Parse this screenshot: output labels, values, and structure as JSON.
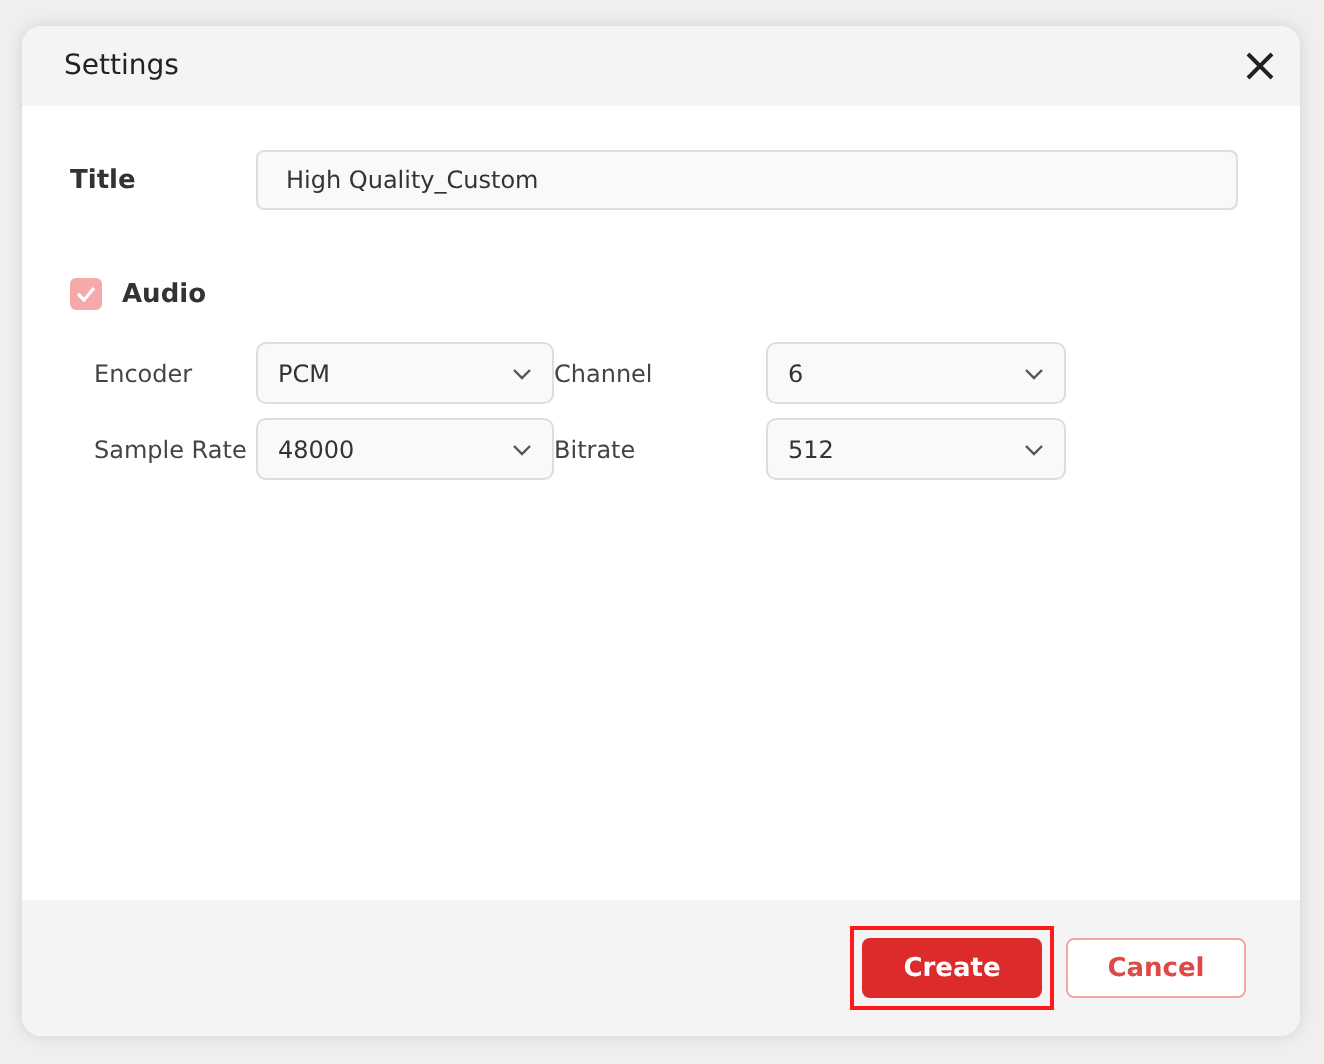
{
  "window": {
    "title": "Settings"
  },
  "title_field": {
    "label": "Title",
    "value": "High Quality_Custom"
  },
  "audio": {
    "label": "Audio",
    "checked": true
  },
  "selects": [
    {
      "label": "Encoder",
      "value": "PCM"
    },
    {
      "label": "Channel",
      "value": "6"
    },
    {
      "label": "Sample Rate",
      "value": "48000"
    },
    {
      "label": "Bitrate",
      "value": "512"
    }
  ],
  "buttons": [
    {
      "label": "Create",
      "kind": "primary",
      "highlighted": true
    },
    {
      "label": "Cancel",
      "kind": "secondary",
      "highlighted": false
    }
  ]
}
